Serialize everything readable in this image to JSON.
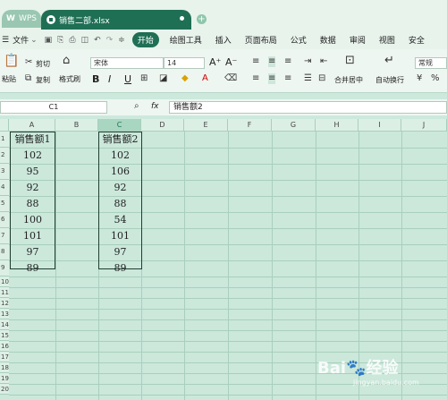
{
  "tabs": {
    "app_label": "WPS",
    "file_label": "销售二部.xlsx"
  },
  "menu": {
    "file_label": "文件",
    "items": [
      "开始",
      "绘图工具",
      "插入",
      "页面布局",
      "公式",
      "数据",
      "审阅",
      "视图",
      "安全"
    ],
    "active_index": 0
  },
  "ribbon": {
    "paste": "粘贴",
    "cut": "剪切",
    "copy": "复制",
    "format_painter": "格式刷",
    "font_name": "宋体",
    "font_size": "14",
    "merge_center": "合并居中",
    "auto_wrap": "自动换行",
    "number_format": "常规",
    "bold": "B",
    "italic": "I",
    "underline": "U",
    "font_grow": "A⁺",
    "font_shrink": "A⁻"
  },
  "formula_bar": {
    "name_box": "C1",
    "fx": "fx",
    "value": "销售额2"
  },
  "columns": [
    "A",
    "B",
    "C",
    "D",
    "E",
    "F",
    "G",
    "H",
    "I",
    "J"
  ],
  "active_column": "C",
  "rows": [
    "1",
    "2",
    "3",
    "4",
    "5",
    "6",
    "7",
    "8",
    "9",
    "10",
    "11",
    "12",
    "13",
    "14",
    "15",
    "16",
    "17",
    "18",
    "19",
    "20"
  ],
  "colA": {
    "header": "销售额1",
    "values": [
      "102",
      "95",
      "92",
      "88",
      "100",
      "101",
      "97",
      "89"
    ]
  },
  "colC": {
    "header": "销售额2",
    "values": [
      "102",
      "106",
      "92",
      "88",
      "54",
      "101",
      "97",
      "89"
    ]
  },
  "watermark": {
    "brand": "Bai",
    "text": "经验",
    "url": "jingyan.baidu.com"
  },
  "colors": {
    "accent": "#1f6f55",
    "grid_bg": "#cbe8db"
  }
}
